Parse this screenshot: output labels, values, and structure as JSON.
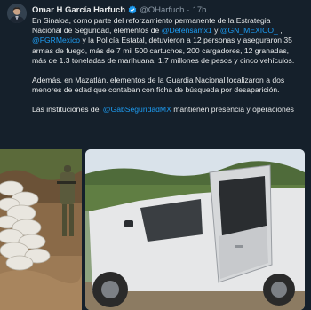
{
  "author": {
    "name": "Omar H García Harfuch",
    "handle": "@OHarfuch",
    "separator": "·",
    "time": "17h",
    "verified": true
  },
  "tweet": {
    "p1": {
      "t1": "En Sinaloa, como parte del reforzamiento permanente de la Estrategia Nacional de Seguridad, elementos de ",
      "m1": "@Defensamx1",
      "t2": " y ",
      "m2": "@GN_MEXICO_",
      "t3": " , ",
      "m3": "@FGRMexico",
      "t4": " y la Policía Estatal, detuvieron a 12 personas y aseguraron 35 armas de fuego, más de 7 mil 500 cartuchos, 200 cargadores, 12 granadas, más de 1.3 toneladas de marihuana, 1.7 millones de pesos y cinco vehículos."
    },
    "p2": "Además, en Mazatlán, elementos de la Guardia Nacional localizaron a dos menores de edad que contaban con ficha de búsqueda por desaparición.",
    "p3": {
      "t1": "Las instituciones del ",
      "m1": "@GabSeguridadMX",
      "t2": " mantienen presencia y operaciones"
    }
  },
  "colors": {
    "background": "#15202b",
    "text": "#e7e9ea",
    "muted": "#8b98a5",
    "link": "#1d9bf0"
  },
  "media": {
    "images": [
      {
        "icon": "photo-seized-marijuana-sacks"
      },
      {
        "icon": "photo-white-pickup-truck"
      }
    ]
  }
}
